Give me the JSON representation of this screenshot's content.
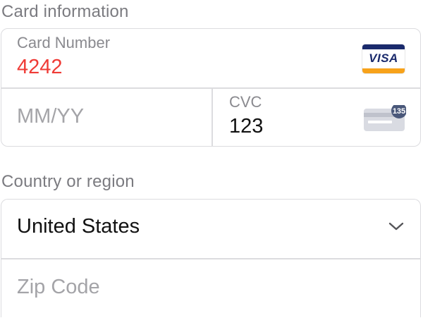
{
  "card_section": {
    "label": "Card information",
    "card_number": {
      "label": "Card Number",
      "value": "4242",
      "value_color": "#ef3b36"
    },
    "brand": {
      "icon": "visa-icon",
      "text": "VISA"
    },
    "expiry": {
      "placeholder": "MM/YY"
    },
    "cvc": {
      "label": "CVC",
      "value": "123",
      "icon": "cvc-card-icon",
      "hint": "135"
    }
  },
  "address_section": {
    "label": "Country or region",
    "country": {
      "value": "United States",
      "icon": "chevron-down-icon"
    },
    "zip": {
      "placeholder": "Zip Code"
    }
  },
  "colors": {
    "border": "#dcdcdf",
    "label": "#7b7b80",
    "placeholder": "#a4a4a8",
    "error": "#ef3b36"
  }
}
